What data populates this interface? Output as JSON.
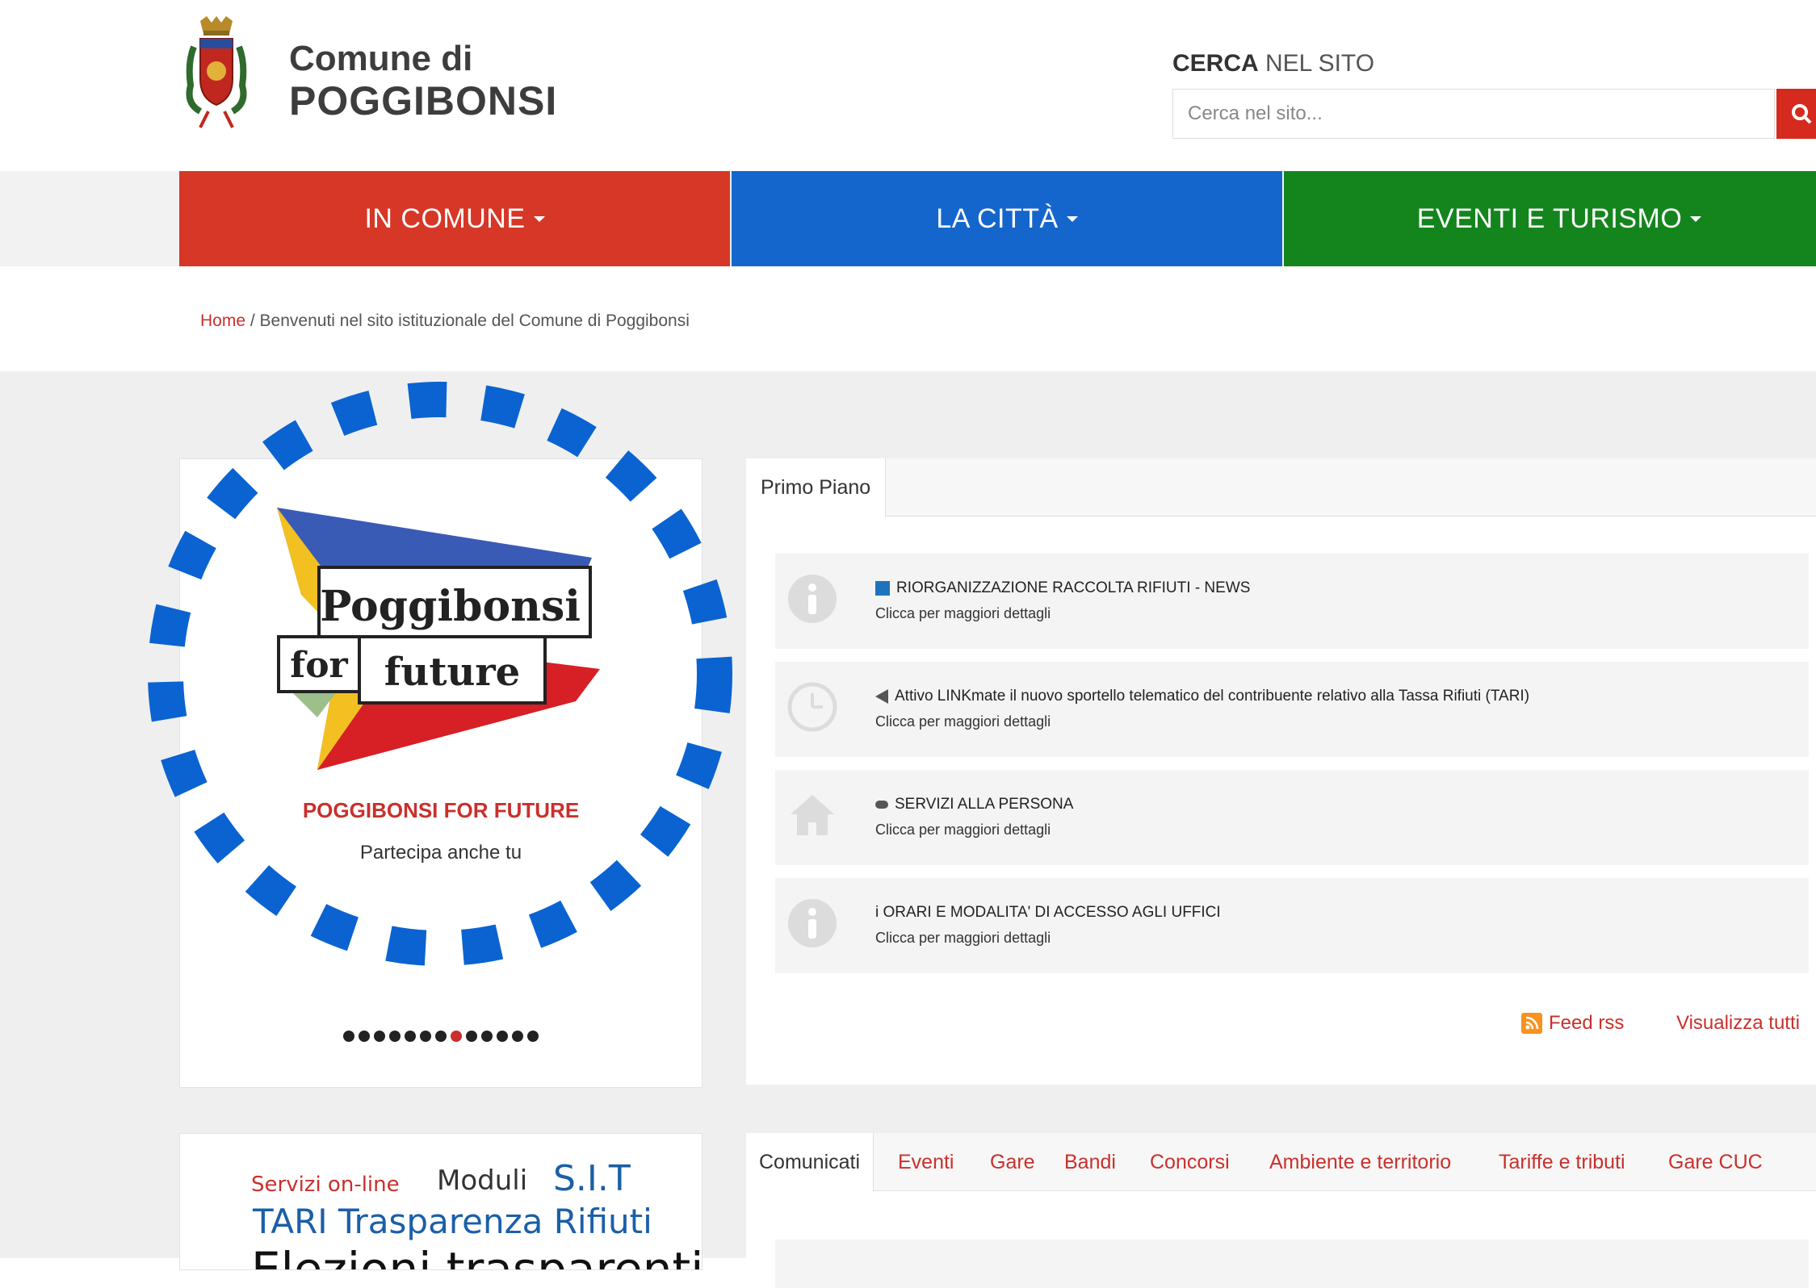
{
  "header": {
    "brand_line1": "Comune di",
    "brand_line2": "POGGIBONSI",
    "search_label_bold": "CERCA",
    "search_label_rest": " NEL SITO",
    "search_placeholder": "Cerca nel sito..."
  },
  "nav": {
    "items": [
      {
        "label": "IN COMUNE",
        "color": "#d63726"
      },
      {
        "label": "LA CITTÀ",
        "color": "#1566cc"
      },
      {
        "label": "EVENTI E TURISMO",
        "color": "#14851d"
      }
    ]
  },
  "breadcrumb": {
    "home": "Home",
    "separator": " / ",
    "current": "Benvenuti nel sito istituzionale del Comune di Poggibonsi"
  },
  "carousel": {
    "logo_word1": "Poggibonsi",
    "logo_word2": "for",
    "logo_word3": "future",
    "title": "POGGIBONSI FOR FUTURE",
    "subtitle": "Partecipa anche tu",
    "dot_count": 13,
    "active_dot": 8
  },
  "primo_piano": {
    "tab_label": "Primo Piano",
    "items": [
      {
        "icon": "info-icon",
        "title": "RIORGANIZZAZIONE RACCOLTA RIFIUTI - NEWS",
        "subtitle": "Clicca per maggiori dettagli"
      },
      {
        "icon": "clock-icon",
        "title": "Attivo LINKmate il nuovo sportello telematico del contribuente relativo alla Tassa Rifiuti (TARI)",
        "subtitle": "Clicca per maggiori dettagli"
      },
      {
        "icon": "home-icon",
        "title": "SERVIZI ALLA PERSONA",
        "subtitle": "Clicca per maggiori dettagli"
      },
      {
        "icon": "info-icon",
        "title": "i ORARI E MODALITA' DI ACCESSO AGLI UFFICI",
        "subtitle": "Clicca per maggiori dettagli"
      }
    ],
    "feed_label": "Feed rss",
    "see_all_label": "Visualizza tutti"
  },
  "services": {
    "online": "Servizi on-line",
    "moduli": "Moduli",
    "sit": "S.I.T",
    "tari": "TARI Trasparenza Rifiuti",
    "elezioni": "Elezioni trasparenti"
  },
  "tabs": {
    "items": [
      "Comunicati",
      "Eventi",
      "Gare",
      "Bandi",
      "Concorsi",
      "Ambiente e territorio",
      "Tariffe e tributi",
      "Gare CUC"
    ]
  },
  "colors": {
    "accent_red": "#c9302c",
    "overlay_blue": "#0a63d1"
  }
}
